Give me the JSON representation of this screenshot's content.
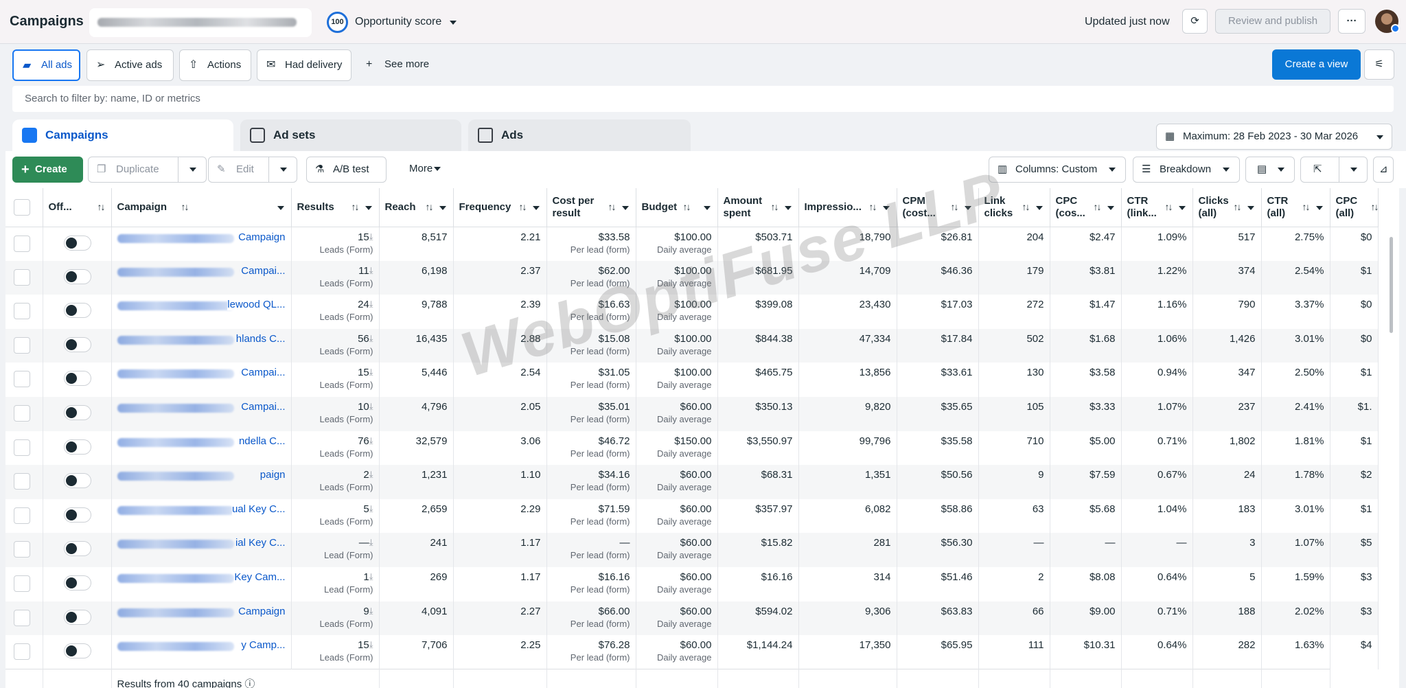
{
  "header": {
    "title": "Campaigns",
    "opportunity_score_value": "100",
    "opportunity_score_label": "Opportunity score",
    "updated": "Updated just now",
    "review_publish": "Review and publish",
    "more": "···"
  },
  "views": {
    "all_ads": "All ads",
    "active_ads": "Active ads",
    "actions": "Actions",
    "had_delivery": "Had delivery",
    "see_more": "See more",
    "create_view": "Create a view"
  },
  "search": {
    "placeholder": "Search to filter by: name, ID or metrics"
  },
  "level_tabs": {
    "campaigns": "Campaigns",
    "ad_sets": "Ad sets",
    "ads": "Ads"
  },
  "date_range": "Maximum: 28 Feb 2023 - 30 Mar 2026",
  "toolbar": {
    "create": "Create",
    "duplicate": "Duplicate",
    "edit": "Edit",
    "ab_test": "A/B test",
    "more": "More",
    "columns": "Columns: Custom",
    "breakdown": "Breakdown"
  },
  "columns": {
    "off": "Off...",
    "campaign": "Campaign",
    "results": "Results",
    "reach": "Reach",
    "frequency": "Frequency",
    "cost_per_result": "Cost per result",
    "budget": "Budget",
    "amount_spent": "Amount spent",
    "impressions": "Impressio...",
    "cpm": "CPM (cost...",
    "link_clicks": "Link clicks",
    "cpc": "CPC (cos...",
    "ctr_link": "CTR (link...",
    "clicks_all": "Clicks (all)",
    "ctr_all": "CTR (all)",
    "cpc_all": "CPC (all)"
  },
  "rows": [
    {
      "name_tail": "Campaign",
      "results": "15",
      "results_sub": "Leads (Form)",
      "reach": "8,517",
      "frequency": "2.21",
      "cpr": "$33.58",
      "cpr_sub": "Per lead (form)",
      "budget": "$100.00",
      "budget_sub": "Daily average",
      "spent": "$503.71",
      "impressions": "18,790",
      "cpm": "$26.81",
      "link_clicks": "204",
      "cpc": "$2.47",
      "ctr_link": "1.09%",
      "clicks_all": "517",
      "ctr_all": "2.75%",
      "cpc_all": "$0"
    },
    {
      "name_tail": "Campai...",
      "results": "11",
      "results_sub": "Leads (Form)",
      "reach": "6,198",
      "frequency": "2.37",
      "cpr": "$62.00",
      "cpr_sub": "Per lead (form)",
      "budget": "$100.00",
      "budget_sub": "Daily average",
      "spent": "$681.95",
      "impressions": "14,709",
      "cpm": "$46.36",
      "link_clicks": "179",
      "cpc": "$3.81",
      "ctr_link": "1.22%",
      "clicks_all": "374",
      "ctr_all": "2.54%",
      "cpc_all": "$1"
    },
    {
      "name_tail": "lewood QL...",
      "results": "24",
      "results_sub": "Leads (Form)",
      "reach": "9,788",
      "frequency": "2.39",
      "cpr": "$16.63",
      "cpr_sub": "Per lead (form)",
      "budget": "$100.00",
      "budget_sub": "Daily average",
      "spent": "$399.08",
      "impressions": "23,430",
      "cpm": "$17.03",
      "link_clicks": "272",
      "cpc": "$1.47",
      "ctr_link": "1.16%",
      "clicks_all": "790",
      "ctr_all": "3.37%",
      "cpc_all": "$0"
    },
    {
      "name_tail": "hlands C...",
      "results": "56",
      "results_sub": "Leads (Form)",
      "reach": "16,435",
      "frequency": "2.88",
      "cpr": "$15.08",
      "cpr_sub": "Per lead (form)",
      "budget": "$100.00",
      "budget_sub": "Daily average",
      "spent": "$844.38",
      "impressions": "47,334",
      "cpm": "$17.84",
      "link_clicks": "502",
      "cpc": "$1.68",
      "ctr_link": "1.06%",
      "clicks_all": "1,426",
      "ctr_all": "3.01%",
      "cpc_all": "$0"
    },
    {
      "name_tail": "Campai...",
      "results": "15",
      "results_sub": "Leads (Form)",
      "reach": "5,446",
      "frequency": "2.54",
      "cpr": "$31.05",
      "cpr_sub": "Per lead (form)",
      "budget": "$100.00",
      "budget_sub": "Daily average",
      "spent": "$465.75",
      "impressions": "13,856",
      "cpm": "$33.61",
      "link_clicks": "130",
      "cpc": "$3.58",
      "ctr_link": "0.94%",
      "clicks_all": "347",
      "ctr_all": "2.50%",
      "cpc_all": "$1"
    },
    {
      "name_tail": "Campai...",
      "results": "10",
      "results_sub": "Leads (Form)",
      "reach": "4,796",
      "frequency": "2.05",
      "cpr": "$35.01",
      "cpr_sub": "Per lead (form)",
      "budget": "$60.00",
      "budget_sub": "Daily average",
      "spent": "$350.13",
      "impressions": "9,820",
      "cpm": "$35.65",
      "link_clicks": "105",
      "cpc": "$3.33",
      "ctr_link": "1.07%",
      "clicks_all": "237",
      "ctr_all": "2.41%",
      "cpc_all": "$1."
    },
    {
      "name_tail": "ndella C...",
      "results": "76",
      "results_sub": "Leads (Form)",
      "reach": "32,579",
      "frequency": "3.06",
      "cpr": "$46.72",
      "cpr_sub": "Per lead (form)",
      "budget": "$150.00",
      "budget_sub": "Daily average",
      "spent": "$3,550.97",
      "impressions": "99,796",
      "cpm": "$35.58",
      "link_clicks": "710",
      "cpc": "$5.00",
      "ctr_link": "0.71%",
      "clicks_all": "1,802",
      "ctr_all": "1.81%",
      "cpc_all": "$1"
    },
    {
      "name_tail": "paign",
      "results": "2",
      "results_sub": "Leads (Form)",
      "reach": "1,231",
      "frequency": "1.10",
      "cpr": "$34.16",
      "cpr_sub": "Per lead (form)",
      "budget": "$60.00",
      "budget_sub": "Daily average",
      "spent": "$68.31",
      "impressions": "1,351",
      "cpm": "$50.56",
      "link_clicks": "9",
      "cpc": "$7.59",
      "ctr_link": "0.67%",
      "clicks_all": "24",
      "ctr_all": "1.78%",
      "cpc_all": "$2"
    },
    {
      "name_tail": "ual Key C...",
      "results": "5",
      "results_sub": "Leads (Form)",
      "reach": "2,659",
      "frequency": "2.29",
      "cpr": "$71.59",
      "cpr_sub": "Per lead (form)",
      "budget": "$60.00",
      "budget_sub": "Daily average",
      "spent": "$357.97",
      "impressions": "6,082",
      "cpm": "$58.86",
      "link_clicks": "63",
      "cpc": "$5.68",
      "ctr_link": "1.04%",
      "clicks_all": "183",
      "ctr_all": "3.01%",
      "cpc_all": "$1"
    },
    {
      "name_tail": "ial Key C...",
      "results": "—",
      "results_sub": "Lead (Form)",
      "reach": "241",
      "frequency": "1.17",
      "cpr": "—",
      "cpr_sub": "Per lead (form)",
      "budget": "$60.00",
      "budget_sub": "Daily average",
      "spent": "$15.82",
      "impressions": "281",
      "cpm": "$56.30",
      "link_clicks": "—",
      "cpc": "—",
      "ctr_link": "—",
      "clicks_all": "3",
      "ctr_all": "1.07%",
      "cpc_all": "$5"
    },
    {
      "name_tail": "Key Cam...",
      "results": "1",
      "results_sub": "Lead (Form)",
      "reach": "269",
      "frequency": "1.17",
      "cpr": "$16.16",
      "cpr_sub": "Per lead (form)",
      "budget": "$60.00",
      "budget_sub": "Daily average",
      "spent": "$16.16",
      "impressions": "314",
      "cpm": "$51.46",
      "link_clicks": "2",
      "cpc": "$8.08",
      "ctr_link": "0.64%",
      "clicks_all": "5",
      "ctr_all": "1.59%",
      "cpc_all": "$3"
    },
    {
      "name_tail": "Campaign",
      "results": "9",
      "results_sub": "Leads (Form)",
      "reach": "4,091",
      "frequency": "2.27",
      "cpr": "$66.00",
      "cpr_sub": "Per lead (form)",
      "budget": "$60.00",
      "budget_sub": "Daily average",
      "spent": "$594.02",
      "impressions": "9,306",
      "cpm": "$63.83",
      "link_clicks": "66",
      "cpc": "$9.00",
      "ctr_link": "0.71%",
      "clicks_all": "188",
      "ctr_all": "2.02%",
      "cpc_all": "$3"
    },
    {
      "name_tail": "y Camp...",
      "results": "15",
      "results_sub": "Leads (Form)",
      "reach": "7,706",
      "frequency": "2.25",
      "cpr": "$76.28",
      "cpr_sub": "Per lead (form)",
      "budget": "$60.00",
      "budget_sub": "Daily average",
      "spent": "$1,144.24",
      "impressions": "17,350",
      "cpm": "$65.95",
      "link_clicks": "111",
      "cpc": "$10.31",
      "ctr_link": "0.64%",
      "clicks_all": "282",
      "ctr_all": "1.63%",
      "cpc_all": "$4"
    }
  ],
  "footer": {
    "results_from": "Results from 40 campaigns"
  },
  "watermark": "WebOptiFuse LLP",
  "colors": {
    "accent": "#1877f2",
    "link": "#0a58ca",
    "create": "#2e8b57",
    "create_view": "#0a78d6"
  }
}
